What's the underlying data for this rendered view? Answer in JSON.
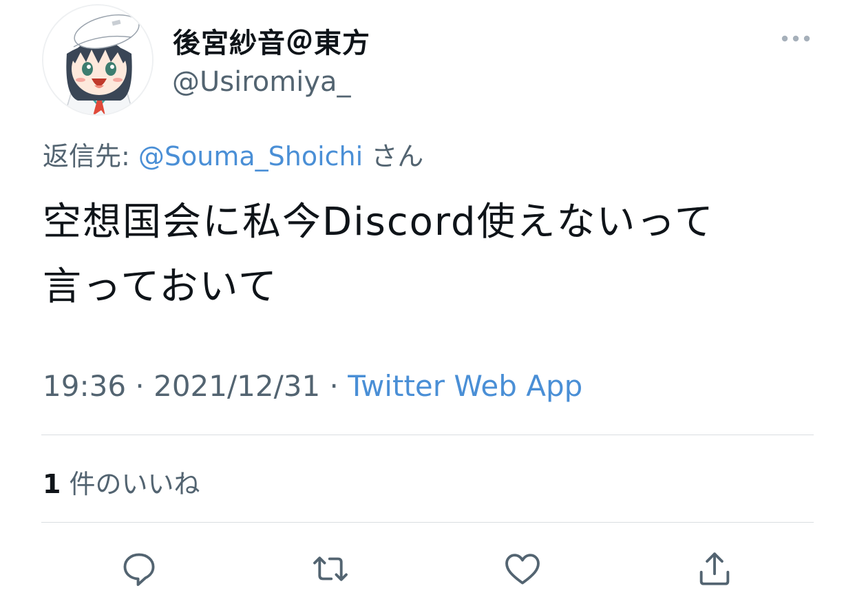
{
  "tweet": {
    "display_name": "後宮紗音＠東方",
    "handle": "@Usiromiya_",
    "reply_prefix": "返信先: ",
    "reply_to": "@Souma_Shoichi",
    "reply_suffix": " さん",
    "text_line1": "空想国会に私今Discord使えないって",
    "text_line2": "言っておいて",
    "time": "19:36",
    "separator": " · ",
    "date": "2021/12/31",
    "source": "Twitter Web App",
    "likes_count": "1",
    "likes_label": " 件のいいね"
  },
  "icons": {
    "more": "more-horizontal-icon",
    "reply": "comment-bubble-icon",
    "retweet": "retweet-icon",
    "like": "heart-icon",
    "share": "share-upload-icon"
  },
  "colors": {
    "text": "#0f1419",
    "secondary": "#536471",
    "link": "#4a8fd6",
    "divider": "#d9dde1"
  }
}
